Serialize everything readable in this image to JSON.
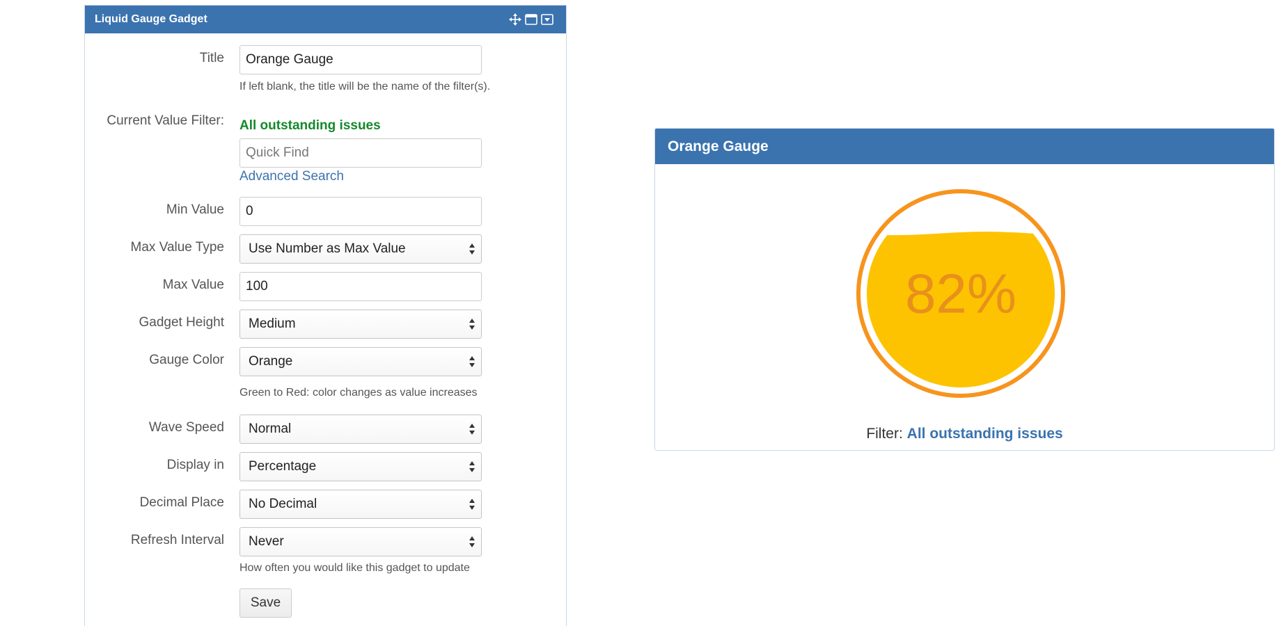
{
  "config": {
    "header_title": "Liquid Gauge Gadget",
    "header_icons": [
      "move-icon",
      "maximize-icon",
      "dropdown-menu-icon"
    ],
    "title_label": "Title",
    "title_value": "Orange Gauge",
    "title_help": "If left blank, the title will be the name of the filter(s).",
    "filter_label": "Current Value Filter:",
    "filter_name": "All outstanding issues",
    "quick_find_placeholder": "Quick Find",
    "advanced_search": "Advanced Search",
    "min_label": "Min Value",
    "min_value": "0",
    "max_type_label": "Max Value Type",
    "max_type_value": "Use Number as Max Value",
    "max_label": "Max Value",
    "max_value": "100",
    "height_label": "Gadget Height",
    "height_value": "Medium",
    "color_label": "Gauge Color",
    "color_value": "Orange",
    "color_help": "Green to Red: color changes as value increases",
    "wave_label": "Wave Speed",
    "wave_value": "Normal",
    "display_label": "Display in",
    "display_value": "Percentage",
    "decimal_label": "Decimal Place",
    "decimal_value": "No Decimal",
    "refresh_label": "Refresh Interval",
    "refresh_value": "Never",
    "refresh_help": "How often you would like this gadget to update",
    "save_label": "Save"
  },
  "gauge": {
    "title": "Orange Gauge",
    "value_text": "82%",
    "fill_fraction": 0.82,
    "filter_label": "Filter:",
    "filter_link": "All outstanding issues",
    "colors": {
      "ring": "#f7941d",
      "liquid": "#fdc300",
      "text": "#e8901c",
      "header": "#3b73af",
      "link": "#3b73af",
      "filter_green": "#14892c"
    }
  }
}
